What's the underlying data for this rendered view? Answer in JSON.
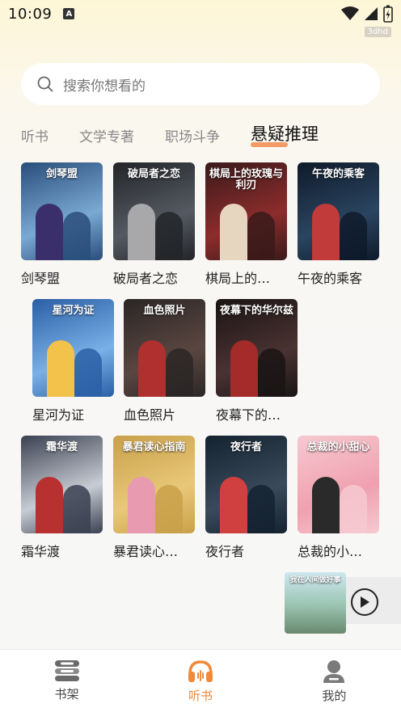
{
  "status": {
    "time": "10:09",
    "watermark": "3dhd"
  },
  "search": {
    "placeholder": "搜索你想看的"
  },
  "tabs": [
    {
      "label": "听书",
      "active": false
    },
    {
      "label": "文学专著",
      "active": false
    },
    {
      "label": "职场斗争",
      "active": false
    },
    {
      "label": "悬疑推理",
      "active": true
    }
  ],
  "books": [
    {
      "title": "剑琴盟",
      "cover_text": "剑琴盟",
      "colors": [
        "#2a4d7a",
        "#7aa9d4",
        "#3b2f6b"
      ]
    },
    {
      "title": "破局者之恋",
      "cover_text": "破局者之恋",
      "colors": [
        "#222428",
        "#555a62",
        "#a8a8aa"
      ]
    },
    {
      "title": "棋局上的…",
      "cover_text": "棋局上的玫瑰与利刃",
      "colors": [
        "#3a1a1a",
        "#8c2c2c",
        "#e6d6c0"
      ]
    },
    {
      "title": "午夜的乘客",
      "cover_text": "午夜的乘客",
      "colors": [
        "#0e1a2a",
        "#2b4560",
        "#c23b3b"
      ]
    },
    {
      "title": "星河为证",
      "cover_text": "星河为证",
      "colors": [
        "#2a5fa6",
        "#79b0e6",
        "#f3c24a"
      ]
    },
    {
      "title": "血色照片",
      "cover_text": "血色照片",
      "colors": [
        "#2a2626",
        "#5a4640",
        "#b03030"
      ]
    },
    {
      "title": "夜幕下的…",
      "cover_text": "夜幕下的华尔兹",
      "colors": [
        "#1a1414",
        "#4a3232",
        "#a52a2a"
      ]
    },
    {
      "title": "霜华渡",
      "cover_text": "霜华渡",
      "colors": [
        "#3a4050",
        "#c8ccd4",
        "#b83030"
      ]
    },
    {
      "title": "暴君读心…",
      "cover_text": "暴君读心指南",
      "colors": [
        "#c9a04a",
        "#e8c878",
        "#e79ab0"
      ]
    },
    {
      "title": "夜行者",
      "cover_text": "夜行者",
      "colors": [
        "#142230",
        "#3a4a5a",
        "#d04040"
      ]
    },
    {
      "title": "总裁的小…",
      "cover_text": "总裁的小甜心",
      "colors": [
        "#f6c9d0",
        "#f0a0b0",
        "#2a2a2a"
      ]
    }
  ],
  "mini_player": {
    "cover_text": "我在人间做好事"
  },
  "bottom_nav": [
    {
      "label": "书架",
      "active": false,
      "icon": "bookshelf-icon"
    },
    {
      "label": "听书",
      "active": true,
      "icon": "headphones-icon"
    },
    {
      "label": "我的",
      "active": false,
      "icon": "profile-icon"
    }
  ]
}
